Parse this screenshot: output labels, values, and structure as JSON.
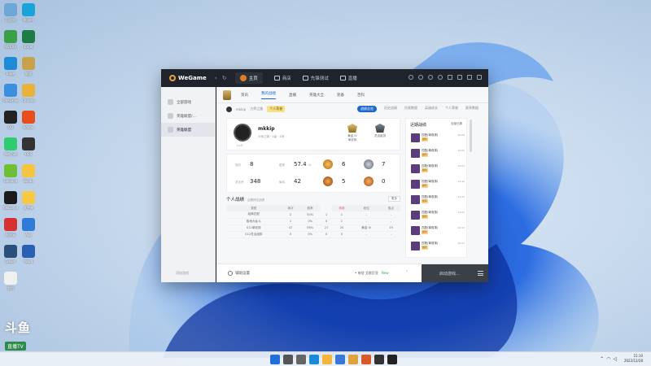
{
  "window": {
    "logo_text": "WeGame",
    "nav_tabs": [
      {
        "label": "主页",
        "active": true,
        "icon": "home-badge-icon"
      },
      {
        "label": "商店",
        "active": false,
        "icon": "shop-icon"
      },
      {
        "label": "先锋测试",
        "active": false,
        "icon": "test-icon"
      },
      {
        "label": "直播",
        "active": false,
        "icon": "live-icon"
      }
    ]
  },
  "sidebar": {
    "items": [
      {
        "label": "全部游戏",
        "active": false
      },
      {
        "label": "英雄联盟/...",
        "active": false
      },
      {
        "label": "英雄联盟",
        "active": true
      }
    ],
    "footer": "添加游戏"
  },
  "game_tabs": [
    "资讯",
    "我的战绩",
    "直播",
    "英雄大全",
    "装备",
    "百科"
  ],
  "game_tabs_active": 1,
  "sub_bar": {
    "left": [
      "mkkip",
      "大师之路"
    ],
    "tag": "个人荣誉",
    "right": [
      "战绩总览",
      "历史战绩",
      "伤害数据",
      "英雄成长",
      "个人荣誉",
      "赛季数据"
    ],
    "right_active": 0
  },
  "profile": {
    "name": "mkkip",
    "meta": "大师之路 · 4级 · 4场",
    "level": "Lv.5",
    "rank1": {
      "title": "黄金 IV",
      "sub": "单双排"
    },
    "rank2": {
      "title": "",
      "sub": "灵活组排"
    }
  },
  "stats": {
    "row1": [
      {
        "label": "场次",
        "value": "8"
      },
      {
        "label": "胜率",
        "value": "57.4",
        "unit": "%"
      },
      {
        "value": "6"
      },
      {
        "value": "7"
      }
    ],
    "row2": [
      {
        "label": "总击杀",
        "value": "348"
      },
      {
        "label": "局均",
        "value": "42"
      },
      {
        "value": "5"
      },
      {
        "value": "0"
      }
    ]
  },
  "history": {
    "title": "个人战绩",
    "subtitle": "近期排位战绩",
    "button": "更多",
    "columns": [
      "类型",
      "场次",
      "胜率",
      "胜场",
      "负场",
      "段位",
      "胜点"
    ],
    "rows": [
      [
        "经典匹配",
        "2",
        "50%",
        "1",
        "1",
        "-",
        "-"
      ],
      [
        "极地大乱斗",
        "1",
        "0%",
        "0",
        "1",
        "-",
        "-"
      ],
      [
        "S12单双排",
        "47",
        "56%",
        "27",
        "20",
        "黄金 IV",
        "19"
      ],
      [
        "S12灵活组排",
        "0",
        "0%",
        "0",
        "0",
        "-",
        "-"
      ]
    ]
  },
  "recent": {
    "title": "近期战绩",
    "filter": "全部比赛",
    "rows": [
      {
        "line1": "匹配(单双排)",
        "tag": "胜利",
        "time": "12:08"
      },
      {
        "line1": "匹配(单双排)",
        "tag": "胜利",
        "time": "12:05"
      },
      {
        "line1": "匹配(单双排)",
        "tag": "胜利",
        "time": "12:01"
      },
      {
        "line1": "匹配(单双排)",
        "tag": "胜利",
        "time": "11:40"
      },
      {
        "line1": "匹配(单双排)",
        "tag": "胜利",
        "time": "11:20"
      },
      {
        "line1": "匹配(单双排)",
        "tag": "胜利",
        "time": "11:02"
      },
      {
        "line1": "匹配(单双排)",
        "tag": "胜利",
        "time": "10:43"
      },
      {
        "line1": "匹配(单双排)",
        "tag": "胜利",
        "time": "10:21"
      }
    ]
  },
  "bottom": {
    "settings": "辅助设置",
    "server": "• 电信 艾欧尼亚",
    "server_new": "New",
    "launch": "启动游戏..."
  },
  "watermark": {
    "top": "斗鱼",
    "sub": "直播TV"
  },
  "taskbar": {
    "time": "15:10",
    "date": "2022/12/28"
  },
  "desktop_icons": [
    {
      "label": "回收站",
      "color": "#6fa6d8"
    },
    {
      "label": "NVIDIA",
      "color": "#3aa047"
    },
    {
      "label": "Edge",
      "color": "#1f8ad6"
    },
    {
      "label": "OneDrive",
      "color": "#3c8ee0"
    },
    {
      "label": "QQ",
      "color": "#222"
    },
    {
      "label": "WeChat",
      "color": "#2ecc71"
    },
    {
      "label": "GeForce",
      "color": "#6fbf35"
    },
    {
      "label": "WeGame",
      "color": "#1b1b1b"
    },
    {
      "label": "网易云",
      "color": "#d63030"
    },
    {
      "label": "Steam",
      "color": "#2a4f7a"
    },
    {
      "label": "文档",
      "color": "#f0f0f0"
    },
    {
      "label": "Player",
      "color": "#1aa3d9"
    },
    {
      "label": "Excel",
      "color": "#1e7b45"
    },
    {
      "label": "联盟",
      "color": "#c8a24a"
    },
    {
      "label": "Chrome",
      "color": "#e9b23b"
    },
    {
      "label": "Adobe",
      "color": "#e84e1b"
    },
    {
      "label": "OBS",
      "color": "#333"
    },
    {
      "label": "Baidu",
      "color": "#f5c542"
    },
    {
      "label": "文件夹",
      "color": "#f6c945"
    },
    {
      "label": "App",
      "color": "#2f7ad6"
    },
    {
      "label": "Word",
      "color": "#2b5fb4"
    }
  ]
}
